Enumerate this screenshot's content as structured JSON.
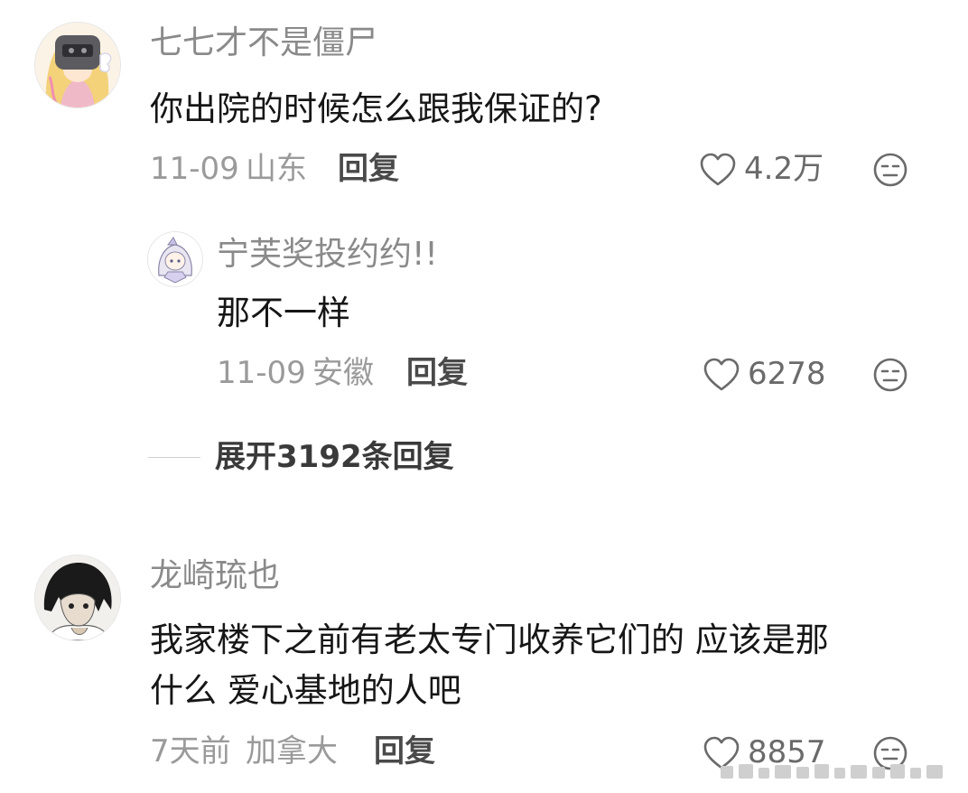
{
  "comments": [
    {
      "username": "七七才不是僵尸",
      "text": "你出院的时候怎么跟我保证的?",
      "date": "11-09",
      "location": "山东",
      "reply_label": "回复",
      "likes": "4.2万",
      "avatar": "armored-anime-girl-avatar"
    },
    {
      "username": "龙崎琉也",
      "text_line1": "我家楼下之前有老太专门收养它们的 应该是那",
      "text_line2": "什么 爱心基地的人吧",
      "date": "7天前",
      "location": "加拿大",
      "reply_label": "回复",
      "likes": "8857",
      "avatar": "dark-haired-man-avatar"
    }
  ],
  "sub_reply": {
    "username": "宁芙奖投约约!!",
    "text": "那不一样",
    "date": "11-09",
    "location": "安徽",
    "reply_label": "回复",
    "likes": "6278",
    "avatar": "chibi-anime-avatar"
  },
  "expand_replies": {
    "label": "展开3192条回复"
  },
  "icons": {
    "like": "heart-outline-icon",
    "dislike": "neutral-face-icon"
  },
  "colors": {
    "username": "#8a8a8a",
    "text": "#161616",
    "meta": "#9a9a9a"
  }
}
